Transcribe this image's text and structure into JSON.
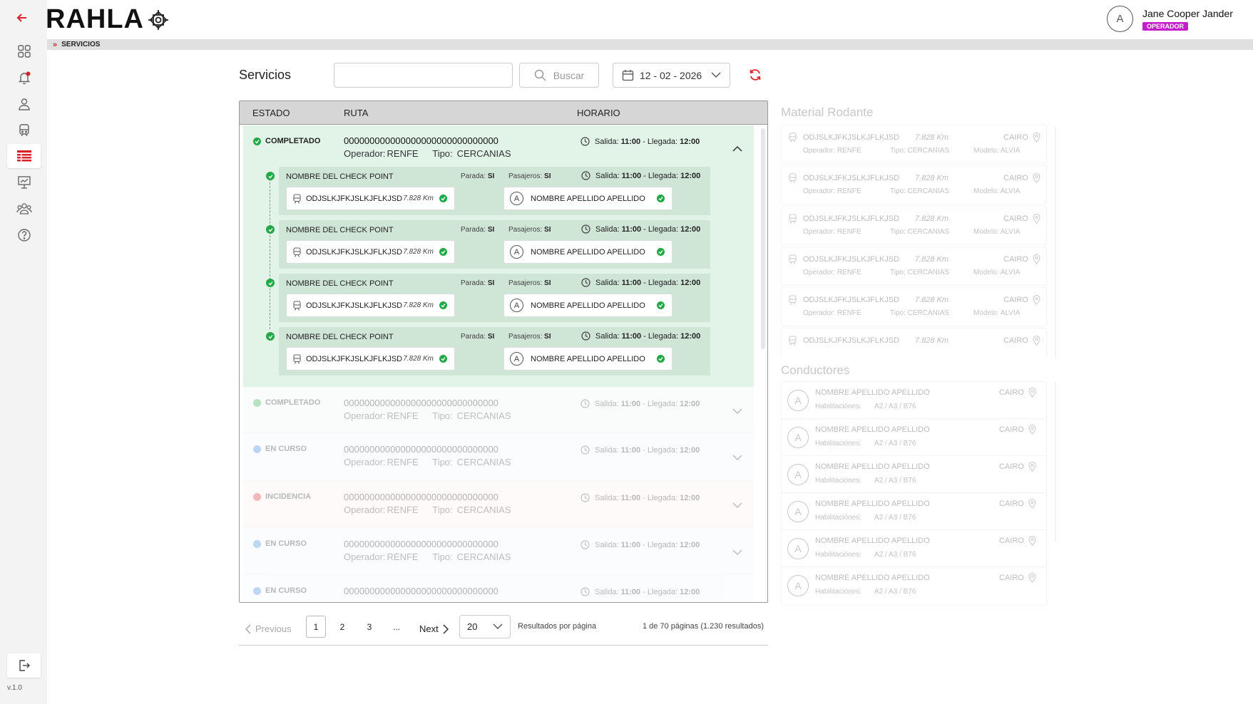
{
  "app": {
    "logo_text": "RAHLA",
    "version": "v.1.0"
  },
  "user": {
    "avatar_initial": "A",
    "name": "Jane Cooper Jander",
    "role": "OPERADOR"
  },
  "breadcrumb": {
    "current": "SERVICIOS"
  },
  "page": {
    "title": "Servicios"
  },
  "search": {
    "placeholder": "",
    "button_label": "Buscar"
  },
  "date_filter": {
    "value": "12 - 02 - 2026"
  },
  "table": {
    "headers": {
      "estado": "ESTADO",
      "ruta": "RUTA",
      "horario": "HORARIO"
    },
    "labels": {
      "operador": "Operador:",
      "tipo": "Tipo:",
      "salida": "Salida:",
      "llegada": "- Llegada:",
      "parada": "Parada:",
      "pasajeros": "Pasajeros:"
    },
    "rows": [
      {
        "status": "COMPLETADO",
        "status_color": "#22a845",
        "code": "000000000000000000000000000000",
        "operador": "RENFE",
        "tipo": "CERCANIAS",
        "salida": "11:00",
        "llegada": "12:00",
        "expanded": true
      },
      {
        "status": "COMPLETADO",
        "status_color": "#22a845",
        "code": "000000000000000000000000000000",
        "operador": "RENFE",
        "tipo": "CERCANIAS",
        "salida": "11:00",
        "llegada": "12:00"
      },
      {
        "status": "EN CURSO",
        "status_color": "#2f7fd8",
        "code": "000000000000000000000000000000",
        "operador": "RENFE",
        "tipo": "CERCANIAS",
        "salida": "11:00",
        "llegada": "12:00"
      },
      {
        "status": "INCIDENCIA",
        "status_color": "#d8232a",
        "code": "000000000000000000000000000000",
        "operador": "RENFE",
        "tipo": "CERCANIAS",
        "salida": "11:00",
        "llegada": "12:00"
      },
      {
        "status": "EN CURSO",
        "status_color": "#2f7fd8",
        "code": "000000000000000000000000000000",
        "operador": "RENFE",
        "tipo": "CERCANIAS",
        "salida": "11:00",
        "llegada": "12:00"
      },
      {
        "status": "EN CURSO",
        "status_color": "#2f7fd8",
        "code": "000000000000000000000000000000",
        "salida": "11:00",
        "llegada": "12:00"
      }
    ],
    "checkpoints": [
      {
        "name": "NOMBRE DEL CHECK POINT",
        "parada": "SI",
        "pasajeros": "SI",
        "salida": "11:00",
        "llegada": "12:00",
        "train_code": "ODJSLKJFKJSLKJFLKJSD",
        "km": "7.828 Km",
        "driver": "NOMBRE APELLIDO APELLIDO",
        "driver_initial": "A"
      },
      {
        "name": "NOMBRE DEL CHECK POINT",
        "parada": "SI",
        "pasajeros": "SI",
        "salida": "11:00",
        "llegada": "12:00",
        "train_code": "ODJSLKJFKJSLKJFLKJSD",
        "km": "7.828 Km",
        "driver": "NOMBRE APELLIDO APELLIDO",
        "driver_initial": "A"
      },
      {
        "name": "NOMBRE DEL CHECK POINT",
        "parada": "SI",
        "pasajeros": "SI",
        "salida": "11:00",
        "llegada": "12:00",
        "train_code": "ODJSLKJFKJSLKJFLKJSD",
        "km": "7.828 Km",
        "driver": "NOMBRE APELLIDO APELLIDO",
        "driver_initial": "A"
      },
      {
        "name": "NOMBRE DEL CHECK POINT",
        "parada": "SI",
        "pasajeros": "SI",
        "salida": "11:00",
        "llegada": "12:00",
        "train_code": "ODJSLKJFKJSLKJFLKJSD",
        "km": "7.828 Km",
        "driver": "NOMBRE APELLIDO APELLIDO",
        "driver_initial": "A"
      }
    ]
  },
  "pagination": {
    "previous": "Previous",
    "pages": [
      "1",
      "2",
      "3",
      "..."
    ],
    "next": "Next",
    "page_size": "20",
    "page_size_label": "Resultados por página",
    "summary": "1 de 70 páginas (1.230 resultados)"
  },
  "material": {
    "title": "Material Rodante",
    "labels": {
      "operador": "Operador:",
      "tipo": "Tipo:",
      "modelo": "Modelo:"
    },
    "items": [
      {
        "code": "ODJSLKJFKJSLKJFLKJSD",
        "km": "7.828 Km",
        "city": "CAIRO",
        "operador": "RENFE",
        "tipo": "CERCANIAS",
        "modelo": "ALVIA"
      },
      {
        "code": "ODJSLKJFKJSLKJFLKJSD",
        "km": "7.828 Km",
        "city": "CAIRO",
        "operador": "RENFE",
        "tipo": "CERCANIAS",
        "modelo": "ALVIA"
      },
      {
        "code": "ODJSLKJFKJSLKJFLKJSD",
        "km": "7.828 Km",
        "city": "CAIRO",
        "operador": "RENFE",
        "tipo": "CERCANIAS",
        "modelo": "ALVIA"
      },
      {
        "code": "ODJSLKJFKJSLKJFLKJSD",
        "km": "7.828 Km",
        "city": "CAIRO",
        "operador": "RENFE",
        "tipo": "CERCANIAS",
        "modelo": "ALVIA"
      },
      {
        "code": "ODJSLKJFKJSLKJFLKJSD",
        "km": "7.828 Km",
        "city": "CAIRO",
        "operador": "RENFE",
        "tipo": "CERCANIAS",
        "modelo": "ALVIA"
      },
      {
        "code": "ODJSLKJFKJSLKJFLKJSD",
        "km": "7.828 Km",
        "city": "CAIRO"
      }
    ]
  },
  "conductores": {
    "title": "Conductores",
    "hab_label": "Habilitaciónes:",
    "items": [
      {
        "initial": "A",
        "name": "NOMBRE APELLIDO APELLIDO",
        "city": "CAIRO",
        "habilitaciones": "A2 / A3 / B76"
      },
      {
        "initial": "A",
        "name": "NOMBRE APELLIDO APELLIDO",
        "city": "CAIRO",
        "habilitaciones": "A2 / A3 / B76"
      },
      {
        "initial": "A",
        "name": "NOMBRE APELLIDO APELLIDO",
        "city": "CAIRO",
        "habilitaciones": "A2 / A3 / B76"
      },
      {
        "initial": "A",
        "name": "NOMBRE APELLIDO APELLIDO",
        "city": "CAIRO",
        "habilitaciones": "A2 / A3 / B76"
      },
      {
        "initial": "A",
        "name": "NOMBRE APELLIDO APELLIDO",
        "city": "CAIRO",
        "habilitaciones": "A2 / A3 / B76"
      },
      {
        "initial": "A",
        "name": "NOMBRE APELLIDO APELLIDO",
        "city": "CAIRO",
        "habilitaciones": "A2 / A3 / B76"
      }
    ]
  },
  "colors": {
    "brand_red": "#d8232a",
    "success": "#22a845",
    "in_progress": "#2f7fd8",
    "incident": "#d8232a",
    "role_badge": "#c21ec9",
    "expanded_row_bg": "#e2f3e7"
  }
}
